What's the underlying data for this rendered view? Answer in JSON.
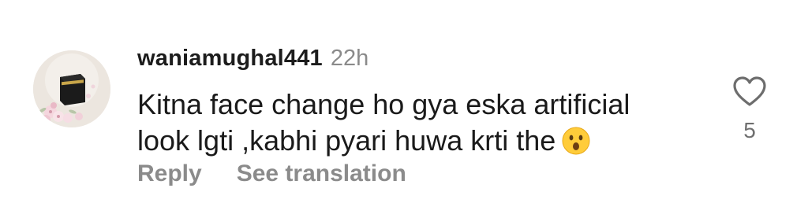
{
  "comment": {
    "username": "waniamughal441",
    "time": "22h",
    "line1": "Kitna face change ho gya eska artificial",
    "line2": "look lgti ,kabhi pyari huwa krti the",
    "emoji": "hushed-face-emoji",
    "like_count": "5"
  },
  "actions": {
    "reply_label": "Reply",
    "see_translation_label": "See translation"
  },
  "icons": {
    "like": "heart-icon"
  },
  "colors": {
    "username": "#1c1c1c",
    "secondary": "#8a8a8a"
  }
}
